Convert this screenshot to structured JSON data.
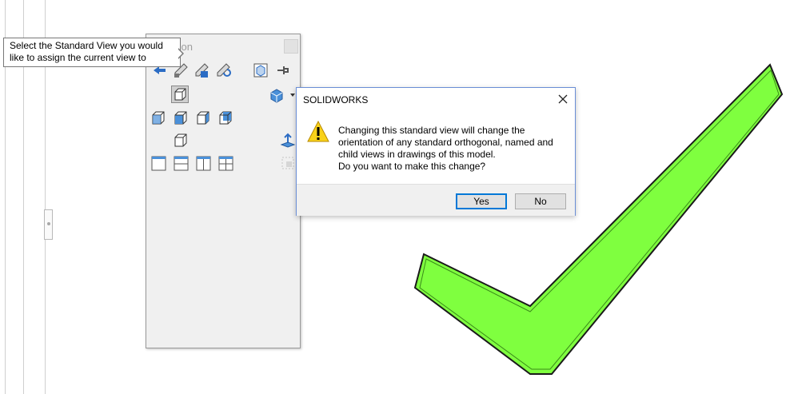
{
  "tooltip": {
    "line1": "Select the Standard View you would",
    "line2": "like to assign the current view to"
  },
  "panel": {
    "title_partial": "tion",
    "toolbar_icons": [
      "previous-view-icon",
      "edit-view-icon",
      "update-standard-views-icon",
      "reset-standard-views-icon",
      "new-view-icon",
      "pin-icon"
    ],
    "view_icons": [
      "front-view-icon",
      "top-view-icon",
      "left-view-icon",
      "back-view-icon",
      "right-view-icon",
      "bottom-view-icon",
      "single-viewport-icon",
      "two-view-horizontal-icon",
      "two-view-vertical-icon",
      "four-view-icon"
    ]
  },
  "dialog": {
    "title": "SOLIDWORKS",
    "message": [
      "Changing this standard view will change the",
      "orientation of any standard orthogonal, named and",
      "child views in drawings of this model.",
      "Do you want to make this change?"
    ],
    "yes_label": "Yes",
    "no_label": "No",
    "icon": "warning-icon"
  },
  "overlay": {
    "icon": "checkmark-icon",
    "color": "#7fff3f"
  }
}
